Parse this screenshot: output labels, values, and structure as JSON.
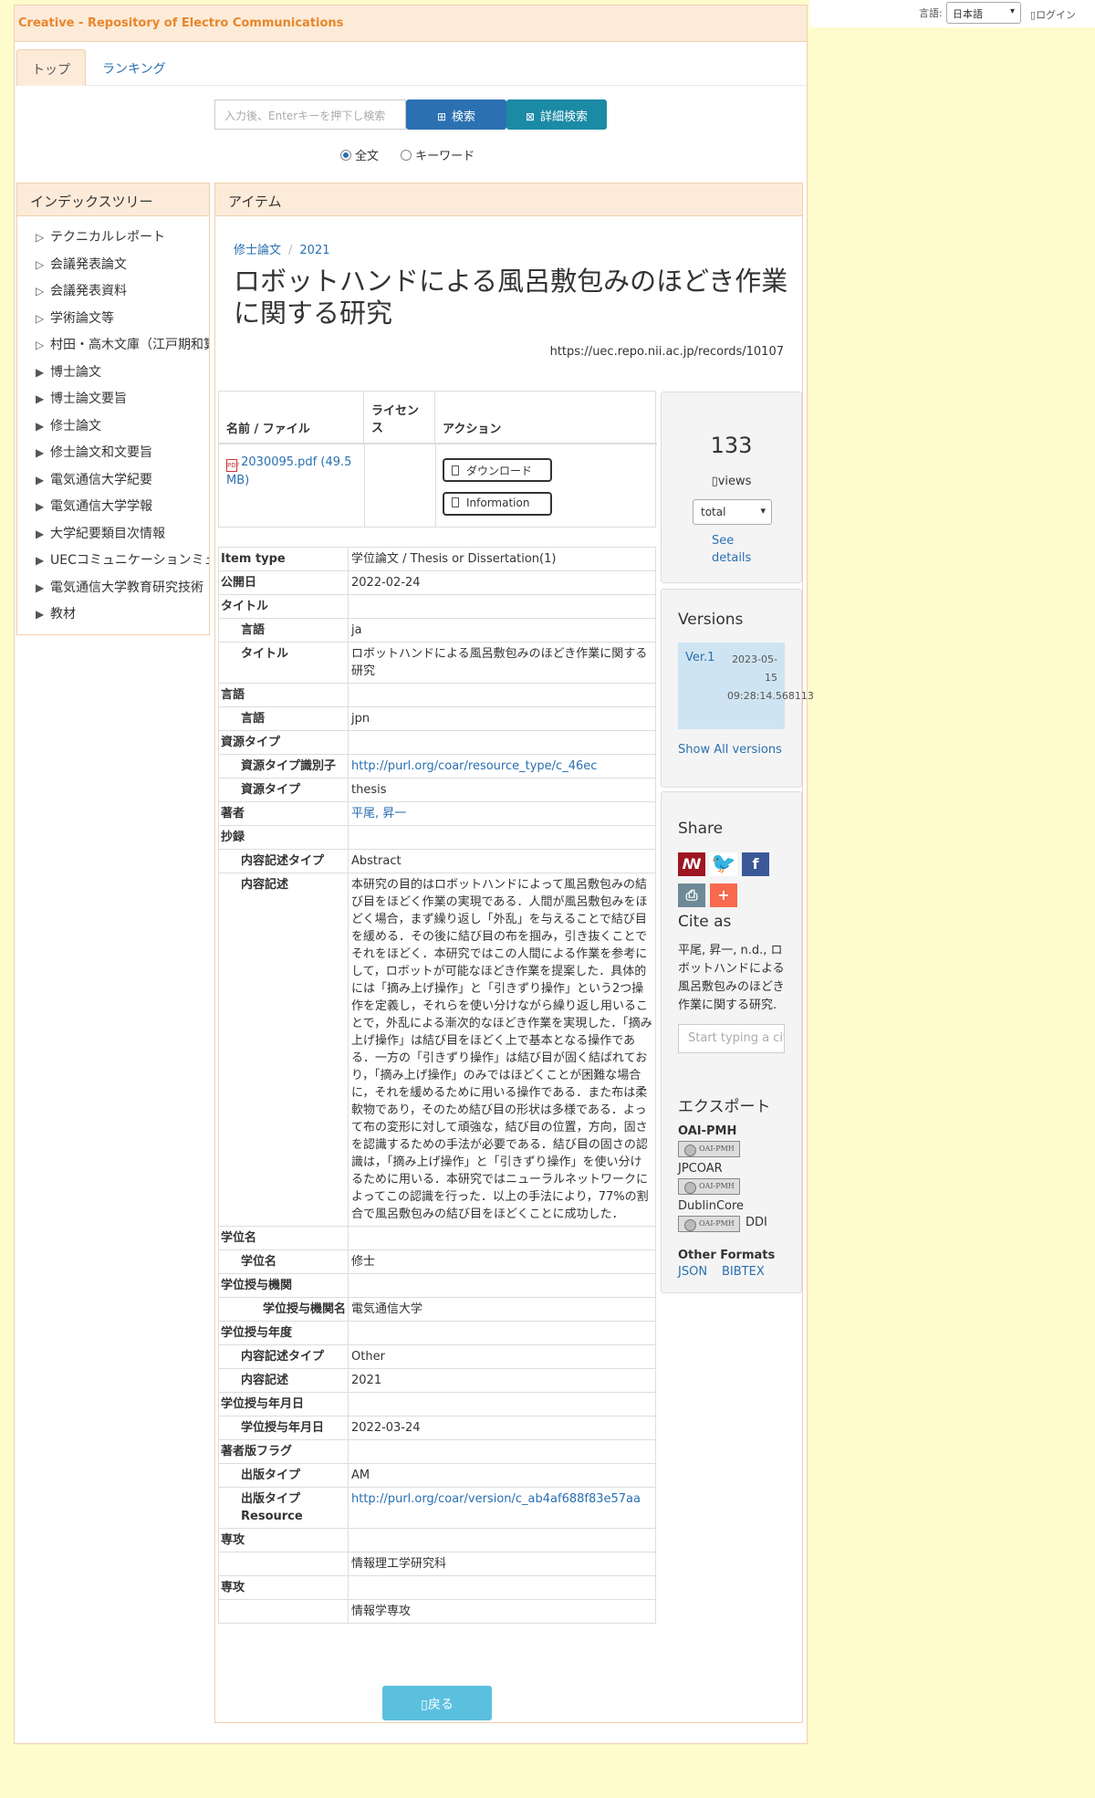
{
  "topbar": {
    "lang_label": "言語:",
    "lang_value": "日本語",
    "login": "ログイン"
  },
  "brand": {
    "title": "Creative - Repository of Electro Communications"
  },
  "nav": {
    "tabs": [
      "トップ",
      "ランキング"
    ]
  },
  "search": {
    "placeholder": "入力後、Enterキーを押下し検索",
    "search_button": "検索",
    "advanced_button": "詳細検索",
    "radio_fulltext": "全文",
    "radio_keyword": "キーワード"
  },
  "tree": {
    "title": "インデックスツリー",
    "items": [
      {
        "label": "テクニカルレポート",
        "expandable": false
      },
      {
        "label": "会議発表論文",
        "expandable": false
      },
      {
        "label": "会議発表資料",
        "expandable": false
      },
      {
        "label": "学術論文等",
        "expandable": false
      },
      {
        "label": "村田・高木文庫（江戸期和算書）",
        "expandable": false
      },
      {
        "label": "博士論文",
        "expandable": true
      },
      {
        "label": "博士論文要旨",
        "expandable": true
      },
      {
        "label": "修士論文",
        "expandable": true
      },
      {
        "label": "修士論文和文要旨",
        "expandable": true
      },
      {
        "label": "電気通信大学紀要",
        "expandable": true
      },
      {
        "label": "電気通信大学学報",
        "expandable": true
      },
      {
        "label": "大学紀要類目次情報",
        "expandable": true
      },
      {
        "label": "UECコミュニケーションミュージアム",
        "expandable": true
      },
      {
        "label": "電気通信大学教育研究技術",
        "expandable": true
      },
      {
        "label": "教材",
        "expandable": true
      }
    ]
  },
  "item": {
    "panel_title": "アイテム",
    "breadcrumb": [
      "修士論文",
      "2021"
    ],
    "title": "ロボットハンドによる風呂敷包みのほどき作業に関する研究",
    "url": "https://uec.repo.nii.ac.jp/records/10107",
    "file_table": {
      "col_name": "名前 / ファイル",
      "col_license": "ライセンス",
      "col_action": "アクション",
      "file_name": "2030095.pdf (49.5 MB)",
      "download": "ダウンロード",
      "information": "Information"
    },
    "metadata": [
      {
        "k": "Item type",
        "v": "学位論文 / Thesis or Dissertation(1)",
        "lvl": 0
      },
      {
        "k": "公開日",
        "v": "2022-02-24",
        "lvl": 0
      },
      {
        "k": "タイトル",
        "v": "",
        "lvl": 0
      },
      {
        "k": "言語",
        "v": "ja",
        "lvl": 1
      },
      {
        "k": "タイトル",
        "v": "ロボットハンドによる風呂敷包みのほどき作業に関する研究",
        "lvl": 1
      },
      {
        "k": "言語",
        "v": "",
        "lvl": 0
      },
      {
        "k": "言語",
        "v": "jpn",
        "lvl": 1
      },
      {
        "k": "資源タイプ",
        "v": "",
        "lvl": 0
      },
      {
        "k": "資源タイプ識別子",
        "v": "http://purl.org/coar/resource_type/c_46ec",
        "lvl": 1,
        "link": true
      },
      {
        "k": "資源タイプ",
        "v": "thesis",
        "lvl": 1
      },
      {
        "k": "著者",
        "v": "平尾, 昇一",
        "lvl": 0,
        "link": true
      },
      {
        "k": "抄録",
        "v": "",
        "lvl": 0
      },
      {
        "k": "内容記述タイプ",
        "v": "Abstract",
        "lvl": 1
      },
      {
        "k": "内容記述",
        "v": "本研究の目的はロボットハンドによって風呂敷包みの結び目をほどく作業の実現である．人間が風呂敷包みをほどく場合，まず繰り返し「外乱」を与えることで結び目を緩める．その後に結び目の布を掴み，引き抜くことでそれをほどく．本研究ではこの人間による作業を参考にして，ロボットが可能なほどき作業を提案した．具体的には「摘み上げ操作」と「引きずり操作」という2つ操作を定義し，それらを使い分けながら繰り返し用いることで，外乱による漸次的なほどき作業を実現した．「摘み上げ操作」は結び目をほどく上で基本となる操作である．一方の「引きずり操作」は結び目が固く結ばれており，「摘み上げ操作」のみではほどくことが困難な場合に，それを緩めるために用いる操作である．また布は柔軟物であり，そのため結び目の形状は多様である．よって布の変形に対して頑強な，結び目の位置，方向，固さを認識するための手法が必要である．結び目の固さの認識は，「摘み上げ操作」と「引きずり操作」を使い分けるために用いる．本研究ではニューラルネットワークによってこの認識を行った．以上の手法により，77%の割合で風呂敷包みの結び目をほどくことに成功した．",
        "lvl": 1
      },
      {
        "k": "学位名",
        "v": "",
        "lvl": 0
      },
      {
        "k": "学位名",
        "v": "修士",
        "lvl": 1
      },
      {
        "k": "学位授与機関",
        "v": "",
        "lvl": 0
      },
      {
        "k": "学位授与機関名",
        "v": "電気通信大学",
        "lvl": 2
      },
      {
        "k": "学位授与年度",
        "v": "",
        "lvl": 0
      },
      {
        "k": "内容記述タイプ",
        "v": "Other",
        "lvl": 1
      },
      {
        "k": "内容記述",
        "v": "2021",
        "lvl": 1
      },
      {
        "k": "学位授与年月日",
        "v": "",
        "lvl": 0
      },
      {
        "k": "学位授与年月日",
        "v": "2022-03-24",
        "lvl": 1
      },
      {
        "k": "著者版フラグ",
        "v": "",
        "lvl": 0
      },
      {
        "k": "出版タイプ",
        "v": "AM",
        "lvl": 1
      },
      {
        "k": "出版タイプResource",
        "v": "http://purl.org/coar/version/c_ab4af688f83e57aa",
        "lvl": 1,
        "link": true
      },
      {
        "k": "専攻",
        "v": "",
        "lvl": 0
      },
      {
        "k": "",
        "v": "情報理工学研究科",
        "lvl": 1
      },
      {
        "k": "専攻",
        "v": "",
        "lvl": 0
      },
      {
        "k": "",
        "v": "情報学専攻",
        "lvl": 1
      }
    ],
    "back": "戻る"
  },
  "sidebar": {
    "views_count": "133",
    "views_label": "views",
    "views_select": "total",
    "see_details": "See details",
    "versions_title": "Versions",
    "version_name": "Ver.1",
    "version_date": "2023-05-15 09:28:14.568113",
    "show_all": "Show All versions",
    "share_title": "Share",
    "cite_title": "Cite as",
    "cite_text": "平尾, 昇一, n.d., ロボットハンドによる風呂敷包みのほどき作業に関する研究.",
    "cite_placeholder": "Start typing a citation style...",
    "export_title": "エクスポート",
    "oaipmh": "OAI-PMH",
    "jpcoar": "JPCOAR",
    "dublincore": "DublinCore",
    "ddi": "DDI",
    "badge_text": "OAI-PMH",
    "other_formats": "Other Formats",
    "json": "JSON",
    "bibtex": "BIBTEX"
  },
  "colors": {
    "page_bg": "#fefccc",
    "panel_head_bg": "#fdebd9",
    "brand_orange": "#e8862b",
    "link_blue": "#2a6fb0"
  }
}
